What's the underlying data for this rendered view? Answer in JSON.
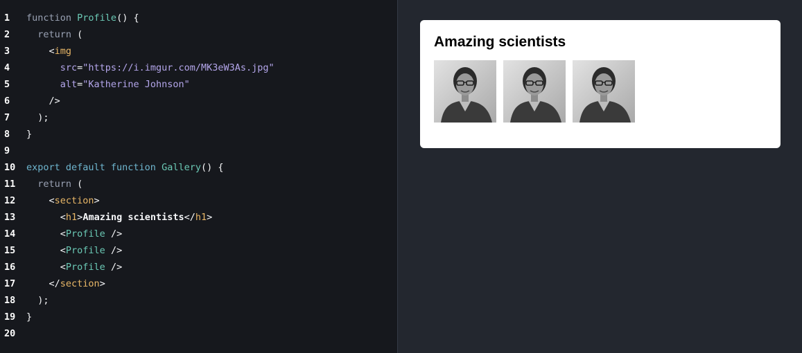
{
  "editor": {
    "lines": [
      {
        "n": "1",
        "tokens": [
          [
            "kw",
            "function "
          ],
          [
            "fn",
            "Profile"
          ],
          [
            "punct",
            "() {"
          ]
        ]
      },
      {
        "n": "2",
        "tokens": [
          [
            "kw",
            "  return "
          ],
          [
            "punct",
            "("
          ]
        ]
      },
      {
        "n": "3",
        "tokens": [
          [
            "punct",
            "    <"
          ],
          [
            "tag",
            "img"
          ]
        ]
      },
      {
        "n": "4",
        "tokens": [
          [
            "attr",
            "      src"
          ],
          [
            "punct",
            "="
          ],
          [
            "str",
            "\"https://i.imgur.com/MK3eW3As.jpg\""
          ]
        ]
      },
      {
        "n": "5",
        "tokens": [
          [
            "attr",
            "      alt"
          ],
          [
            "punct",
            "="
          ],
          [
            "str",
            "\"Katherine Johnson\""
          ]
        ]
      },
      {
        "n": "6",
        "tokens": [
          [
            "punct",
            "    />"
          ]
        ]
      },
      {
        "n": "7",
        "tokens": [
          [
            "punct",
            "  );"
          ]
        ]
      },
      {
        "n": "8",
        "tokens": [
          [
            "punct",
            "}"
          ]
        ]
      },
      {
        "n": "9",
        "tokens": []
      },
      {
        "n": "10",
        "tokens": [
          [
            "kw2",
            "export default function "
          ],
          [
            "fn",
            "Gallery"
          ],
          [
            "punct",
            "() {"
          ]
        ]
      },
      {
        "n": "11",
        "tokens": [
          [
            "kw",
            "  return "
          ],
          [
            "punct",
            "("
          ]
        ]
      },
      {
        "n": "12",
        "tokens": [
          [
            "punct",
            "    <"
          ],
          [
            "tag",
            "section"
          ],
          [
            "punct",
            ">"
          ]
        ]
      },
      {
        "n": "13",
        "tokens": [
          [
            "punct",
            "      <"
          ],
          [
            "tag",
            "h1"
          ],
          [
            "punct",
            ">"
          ],
          [
            "txt",
            "Amazing scientists"
          ],
          [
            "punct",
            "</"
          ],
          [
            "tag",
            "h1"
          ],
          [
            "punct",
            ">"
          ]
        ]
      },
      {
        "n": "14",
        "tokens": [
          [
            "punct",
            "      <"
          ],
          [
            "comp",
            "Profile"
          ],
          [
            "punct",
            " />"
          ]
        ]
      },
      {
        "n": "15",
        "tokens": [
          [
            "punct",
            "      <"
          ],
          [
            "comp",
            "Profile"
          ],
          [
            "punct",
            " />"
          ]
        ]
      },
      {
        "n": "16",
        "tokens": [
          [
            "punct",
            "      <"
          ],
          [
            "comp",
            "Profile"
          ],
          [
            "punct",
            " />"
          ]
        ]
      },
      {
        "n": "17",
        "tokens": [
          [
            "punct",
            "    </"
          ],
          [
            "tag",
            "section"
          ],
          [
            "punct",
            ">"
          ]
        ]
      },
      {
        "n": "18",
        "tokens": [
          [
            "punct",
            "  );"
          ]
        ]
      },
      {
        "n": "19",
        "tokens": [
          [
            "punct",
            "}"
          ]
        ]
      },
      {
        "n": "20",
        "tokens": []
      }
    ]
  },
  "preview": {
    "heading": "Amazing scientists",
    "photos": [
      {
        "alt": "Katherine Johnson"
      },
      {
        "alt": "Katherine Johnson"
      },
      {
        "alt": "Katherine Johnson"
      }
    ]
  }
}
